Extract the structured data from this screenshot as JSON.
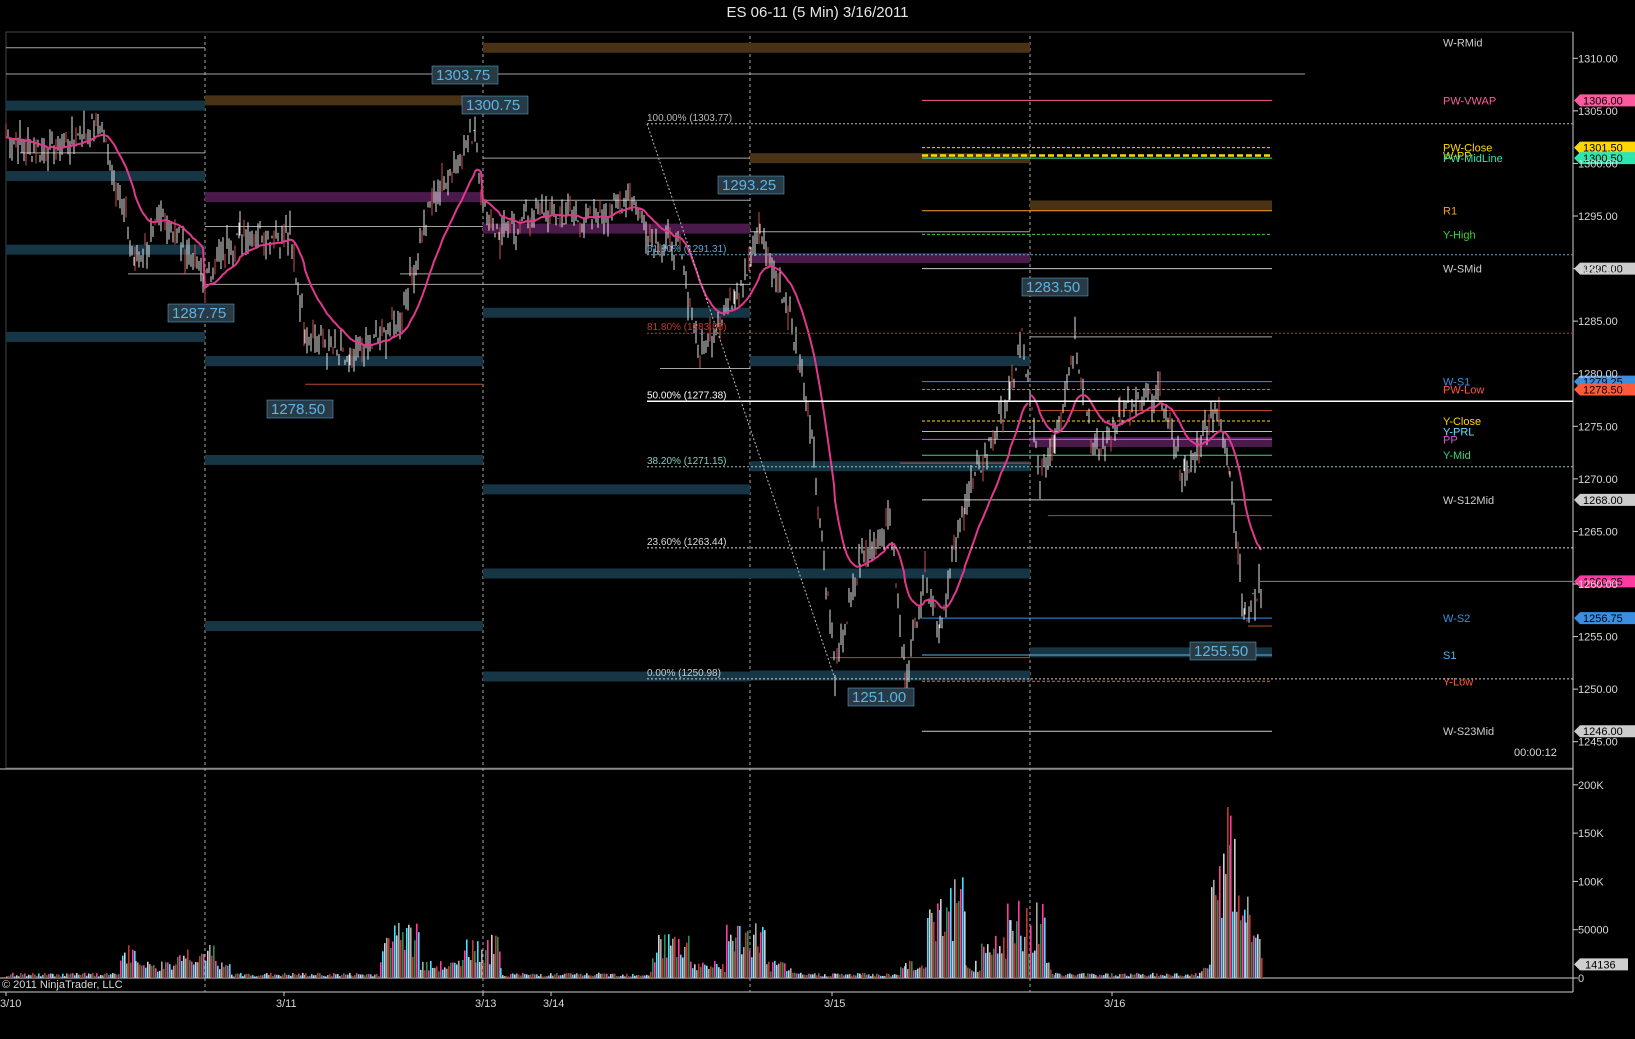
{
  "window": {
    "title": "ES 06-11 (5 Min)  3/16/2011"
  },
  "footer": {
    "copyright": "© 2011 NinjaTrader, LLC",
    "timer": "00:00:12"
  },
  "chart_data": {
    "type": "candlestick",
    "title": "ES 06-11 (5 Min)  3/16/2011",
    "price_axis": {
      "ylim": [
        1242.5,
        1312.5
      ],
      "ticks": [
        "1310.00",
        "1305.00",
        "1300.00",
        "1295.00",
        "1290.00",
        "1285.00",
        "1280.00",
        "1275.00",
        "1270.00",
        "1265.00",
        "1260.00",
        "1255.00",
        "1250.00",
        "1245.00"
      ]
    },
    "volume_axis": {
      "ylim": [
        0,
        205000
      ],
      "ticks": [
        "200K",
        "150K",
        "100K",
        "50000",
        "0"
      ]
    },
    "x_labels": [
      "3/10",
      "3/11",
      "3/13",
      "3/14",
      "3/15",
      "3/16"
    ],
    "callouts": [
      {
        "text": "1303.75"
      },
      {
        "text": "1300.75"
      },
      {
        "text": "1293.25"
      },
      {
        "text": "1287.75"
      },
      {
        "text": "1278.50"
      },
      {
        "text": "1283.50"
      },
      {
        "text": "1251.00"
      },
      {
        "text": "1255.50"
      }
    ],
    "fibonacci": [
      {
        "text": "100.00% (1303.77)",
        "price": 1303.77,
        "color": "#bbbbbb"
      },
      {
        "text": "61.80% (1291.31)",
        "price": 1291.31,
        "color": "#5fa8d3"
      },
      {
        "text": "81.80% (1283.85)",
        "price": 1283.85,
        "color": "#c0392b"
      },
      {
        "text": "50.00% (1277.38)",
        "price": 1277.38,
        "color": "#ffffff"
      },
      {
        "text": "38.20% (1271.15)",
        "price": 1271.15,
        "color": "#7fd0c4"
      },
      {
        "text": "23.60% (1263.44)",
        "price": 1263.44,
        "color": "#dddddd"
      },
      {
        "text": "0.00% (1250.98)",
        "price": 1250.98,
        "color": "#cccccc"
      }
    ],
    "levels": [
      {
        "name": "W-RMid",
        "price": 1311.5,
        "color": "#cccccc",
        "tag": ""
      },
      {
        "name": "PW-VWAP",
        "price": 1306.0,
        "color": "#ff5aa0",
        "tag": "1306.00"
      },
      {
        "name": "PW-Close",
        "price": 1301.5,
        "color": "#ffd700",
        "tag": "1301.50"
      },
      {
        "name": "W-PP",
        "price": 1300.75,
        "color": "#ffd700",
        "tag": ""
      },
      {
        "name": "PW-MidLine",
        "price": 1300.5,
        "color": "#2ee6b0",
        "tag": "1300.50"
      },
      {
        "name": "R1",
        "price": 1295.5,
        "color": "#ff9a2a",
        "tag": ""
      },
      {
        "name": "Y-High",
        "price": 1293.25,
        "color": "#3ad13a",
        "tag": ""
      },
      {
        "name": "W-SMid",
        "price": 1290.0,
        "color": "#cccccc",
        "tag": "1290.00"
      },
      {
        "name": "W-S1",
        "price": 1279.25,
        "color": "#3a8fe0",
        "tag": "1279.25"
      },
      {
        "name": "PW-Low",
        "price": 1278.5,
        "color": "#ff5a3a",
        "tag": "1278.50"
      },
      {
        "name": "Y-Close",
        "price": 1275.5,
        "color": "#ffd700",
        "tag": ""
      },
      {
        "name": "Y-PRL",
        "price": 1274.5,
        "color": "#60e0ff",
        "tag": ""
      },
      {
        "name": "PP",
        "price": 1273.75,
        "color": "#e050e0",
        "tag": ""
      },
      {
        "name": "Y-Mid",
        "price": 1272.25,
        "color": "#40d080",
        "tag": ""
      },
      {
        "name": "W-S12Mid",
        "price": 1268.0,
        "color": "#cccccc",
        "tag": "1268.00"
      },
      {
        "name": "W-S2",
        "price": 1256.75,
        "color": "#3a8fe0",
        "tag": "1256.75"
      },
      {
        "name": "S1",
        "price": 1253.25,
        "color": "#5ab4e6",
        "tag": ""
      },
      {
        "name": "Y-Low",
        "price": 1250.75,
        "color": "#ff5a3a",
        "tag": ""
      },
      {
        "name": "W-S23Mid",
        "price": 1246.0,
        "color": "#cccccc",
        "tag": "1246.00"
      }
    ],
    "last_price": {
      "price": 1260.25,
      "tag": "1260.25",
      "color": "#ff3aa0"
    },
    "last_volume": {
      "value": 14136,
      "tag": "14136"
    },
    "series": [
      {
        "name": "ES 06-11 (5 Min)",
        "color": "#e8e8e8"
      },
      {
        "name": "VWAP",
        "color": "#e0388c"
      }
    ]
  }
}
